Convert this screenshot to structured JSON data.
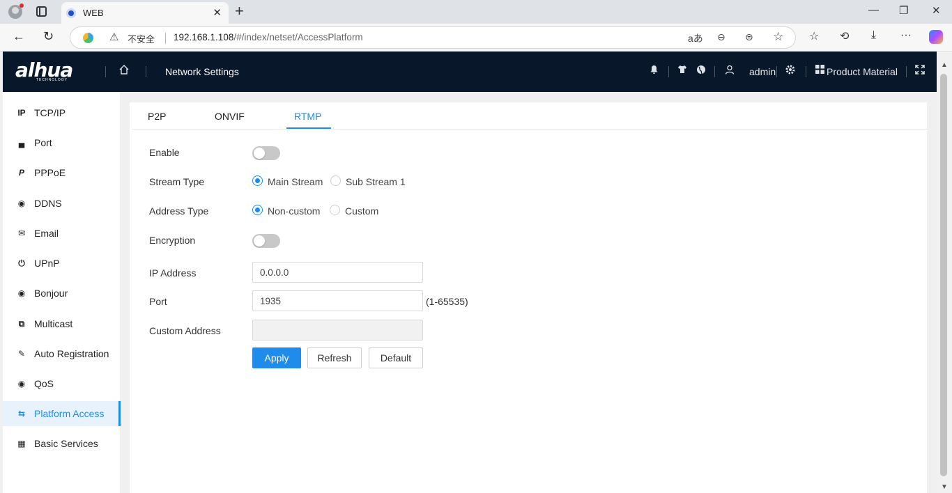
{
  "browser": {
    "tab_title": "WEB",
    "tab_close": "✕",
    "new_tab": "+",
    "security_label": "不安全",
    "url_host": "192.168.1.108",
    "url_path": "/#/index/netset/AccessPlatform",
    "win_minimize": "—",
    "win_restore": "❐",
    "win_close": "✕",
    "back": "←",
    "reload": "↻",
    "read_aloud": "aあ",
    "zoom": "⊖",
    "app_icon": "⊜",
    "favorite": "☆",
    "favorites": "☆",
    "history": "⟲",
    "downloads": "⤓",
    "more": "···"
  },
  "header": {
    "logo": "alhua",
    "logo_sub": "TECHNOLOGY",
    "title": "Network Settings",
    "user": "admin",
    "product_material": "Product Material",
    "icons": {
      "bell": "🔔",
      "shirt": "👕",
      "globe": "●",
      "user": "👤",
      "settings": "⚙",
      "grid": "▦",
      "fullscreen": "⤢"
    }
  },
  "sidebar": {
    "items": [
      {
        "label": "TCP/IP",
        "icon": "IP"
      },
      {
        "label": "Port",
        "icon": "▄"
      },
      {
        "label": "PPPoE",
        "icon": "P"
      },
      {
        "label": "DDNS",
        "icon": "◉"
      },
      {
        "label": "Email",
        "icon": "✉"
      },
      {
        "label": "UPnP",
        "icon": "⏻"
      },
      {
        "label": "Bonjour",
        "icon": "◉"
      },
      {
        "label": "Multicast",
        "icon": "⧉"
      },
      {
        "label": "Auto Registration",
        "icon": "✎"
      },
      {
        "label": "QoS",
        "icon": "◉"
      },
      {
        "label": "Platform Access",
        "icon": "⇆"
      },
      {
        "label": "Basic Services",
        "icon": "▦"
      }
    ],
    "active_index": 10
  },
  "tabs": [
    "P2P",
    "ONVIF",
    "RTMP"
  ],
  "active_tab": "RTMP",
  "form": {
    "enable_label": "Enable",
    "enable_on": false,
    "stream_type_label": "Stream Type",
    "stream_options": [
      "Main Stream",
      "Sub Stream 1"
    ],
    "stream_selected": "Main Stream",
    "address_type_label": "Address Type",
    "address_options": [
      "Non-custom",
      "Custom"
    ],
    "address_selected": "Non-custom",
    "encryption_label": "Encryption",
    "encryption_on": false,
    "ip_label": "IP Address",
    "ip_value": "0.0.0.0",
    "port_label": "Port",
    "port_value": "1935",
    "port_range": "(1-65535)",
    "custom_address_label": "Custom Address",
    "custom_address_value": ""
  },
  "buttons": {
    "apply": "Apply",
    "refresh": "Refresh",
    "default": "Default"
  },
  "colors": {
    "accent": "#1f8ceb",
    "header_bg": "#08172a"
  }
}
